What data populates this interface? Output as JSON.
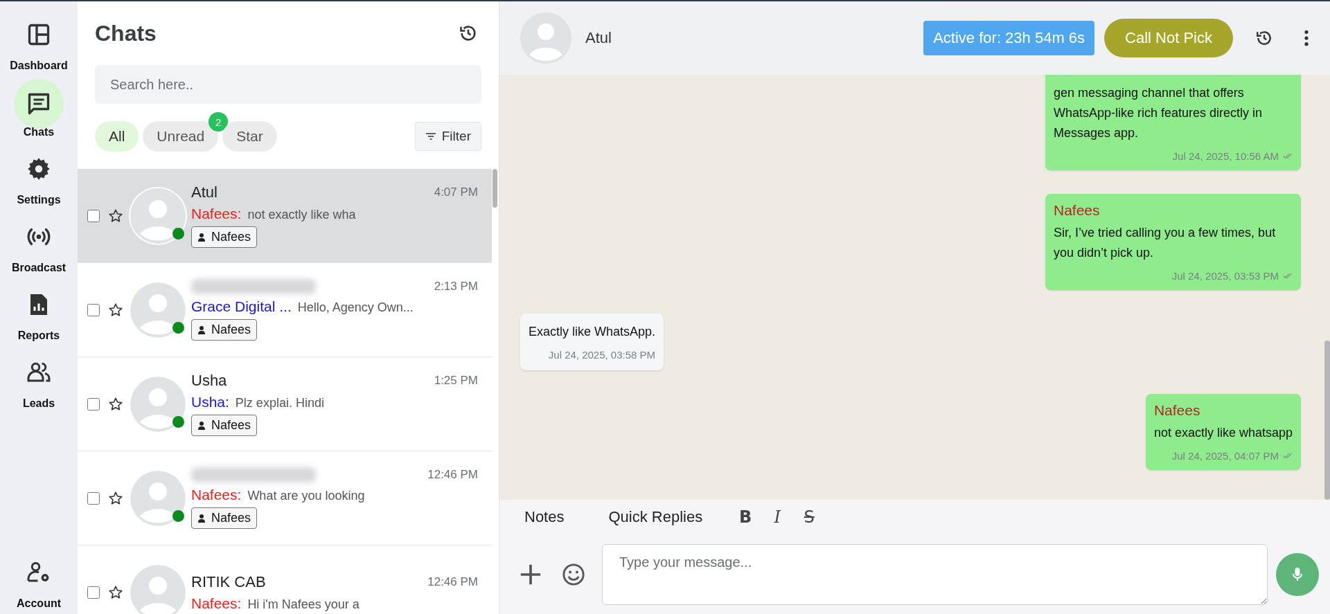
{
  "sidebar": {
    "items": [
      {
        "label": "Dashboard",
        "selected": false
      },
      {
        "label": "Chats",
        "selected": true
      },
      {
        "label": "Settings",
        "selected": false
      },
      {
        "label": "Broadcast",
        "selected": false
      },
      {
        "label": "Reports",
        "selected": false
      },
      {
        "label": "Leads",
        "selected": false
      }
    ],
    "bottom_items": [
      {
        "label": "Account",
        "selected": false
      }
    ]
  },
  "chat_list": {
    "title": "Chats",
    "search": {
      "placeholder": "Search here.."
    },
    "filters": [
      {
        "label": "All",
        "selected": true
      },
      {
        "label": "Unread",
        "selected": false,
        "badge": "2"
      },
      {
        "label": "Star",
        "selected": false
      }
    ],
    "filter_button": "Filter",
    "chats": [
      {
        "name": "Atul",
        "redacted": false,
        "time": "4:07 PM",
        "sender": "Nafees:",
        "color": "#f21b1b",
        "preview": "not exactly like wha",
        "agent": "Nafees",
        "selected": true,
        "checked": false,
        "starred": false,
        "online": true
      },
      {
        "redacted": true,
        "time": "2:13 PM",
        "sender": "Grace Digital ...",
        "color": "#1515e6",
        "preview": "Hello, Agency Own...",
        "agent": "Nafees",
        "selected": false,
        "checked": false,
        "starred": false,
        "online": true
      },
      {
        "name": "Usha",
        "redacted": false,
        "time": "1:25 PM",
        "sender": "Usha:",
        "color": "#1515e6",
        "preview": "Plz explai. Hindi",
        "agent": "Nafees",
        "selected": false,
        "checked": false,
        "starred": false,
        "online": true
      },
      {
        "redacted": true,
        "time": "12:46 PM",
        "sender": "Nafees:",
        "color": "#f21b1b",
        "preview": "What are you looking",
        "agent": "Nafees",
        "selected": false,
        "checked": false,
        "starred": false,
        "online": true
      },
      {
        "name": "RITIK CAB",
        "redacted": false,
        "time": "12:46 PM",
        "sender": "Nafees:",
        "color": "#f21b1b",
        "preview": "Hi i'm Nafees your a",
        "selected": false,
        "checked": false,
        "starred": false,
        "online": false
      }
    ]
  },
  "chat_header": {
    "contact_name": "Atul",
    "active_badge": "Active for: 23h 54m 6s",
    "status_button": "Call Not Pick"
  },
  "messages": [
    {
      "outgoing": true,
      "text": "gen messaging channel that offers WhatsApp-like rich features directly in Messages app.",
      "time": "Jul 24, 2025, 10:56 AM"
    },
    {
      "outgoing": true,
      "sender": "Nafees",
      "text": "Sir, I’ve tried calling you a few times, but you didn’t pick up.",
      "time": "Jul 24, 2025, 03:53 PM"
    },
    {
      "outgoing": false,
      "text": "Exactly like WhatsApp.",
      "time": "Jul 24, 2025, 03:58 PM"
    },
    {
      "outgoing": true,
      "sender": "Nafees",
      "text": "not exactly like whatsapp",
      "time": "Jul 24, 2025, 04:07 PM"
    }
  ],
  "composer": {
    "tabs": [
      "Notes",
      "Quick Replies"
    ],
    "format_buttons": [
      {
        "kind": "bold",
        "glyph": "B"
      },
      {
        "kind": "italic",
        "glyph": "I"
      },
      {
        "kind": "strike",
        "glyph": "S"
      }
    ],
    "input": {
      "placeholder": "Type your message..."
    }
  }
}
